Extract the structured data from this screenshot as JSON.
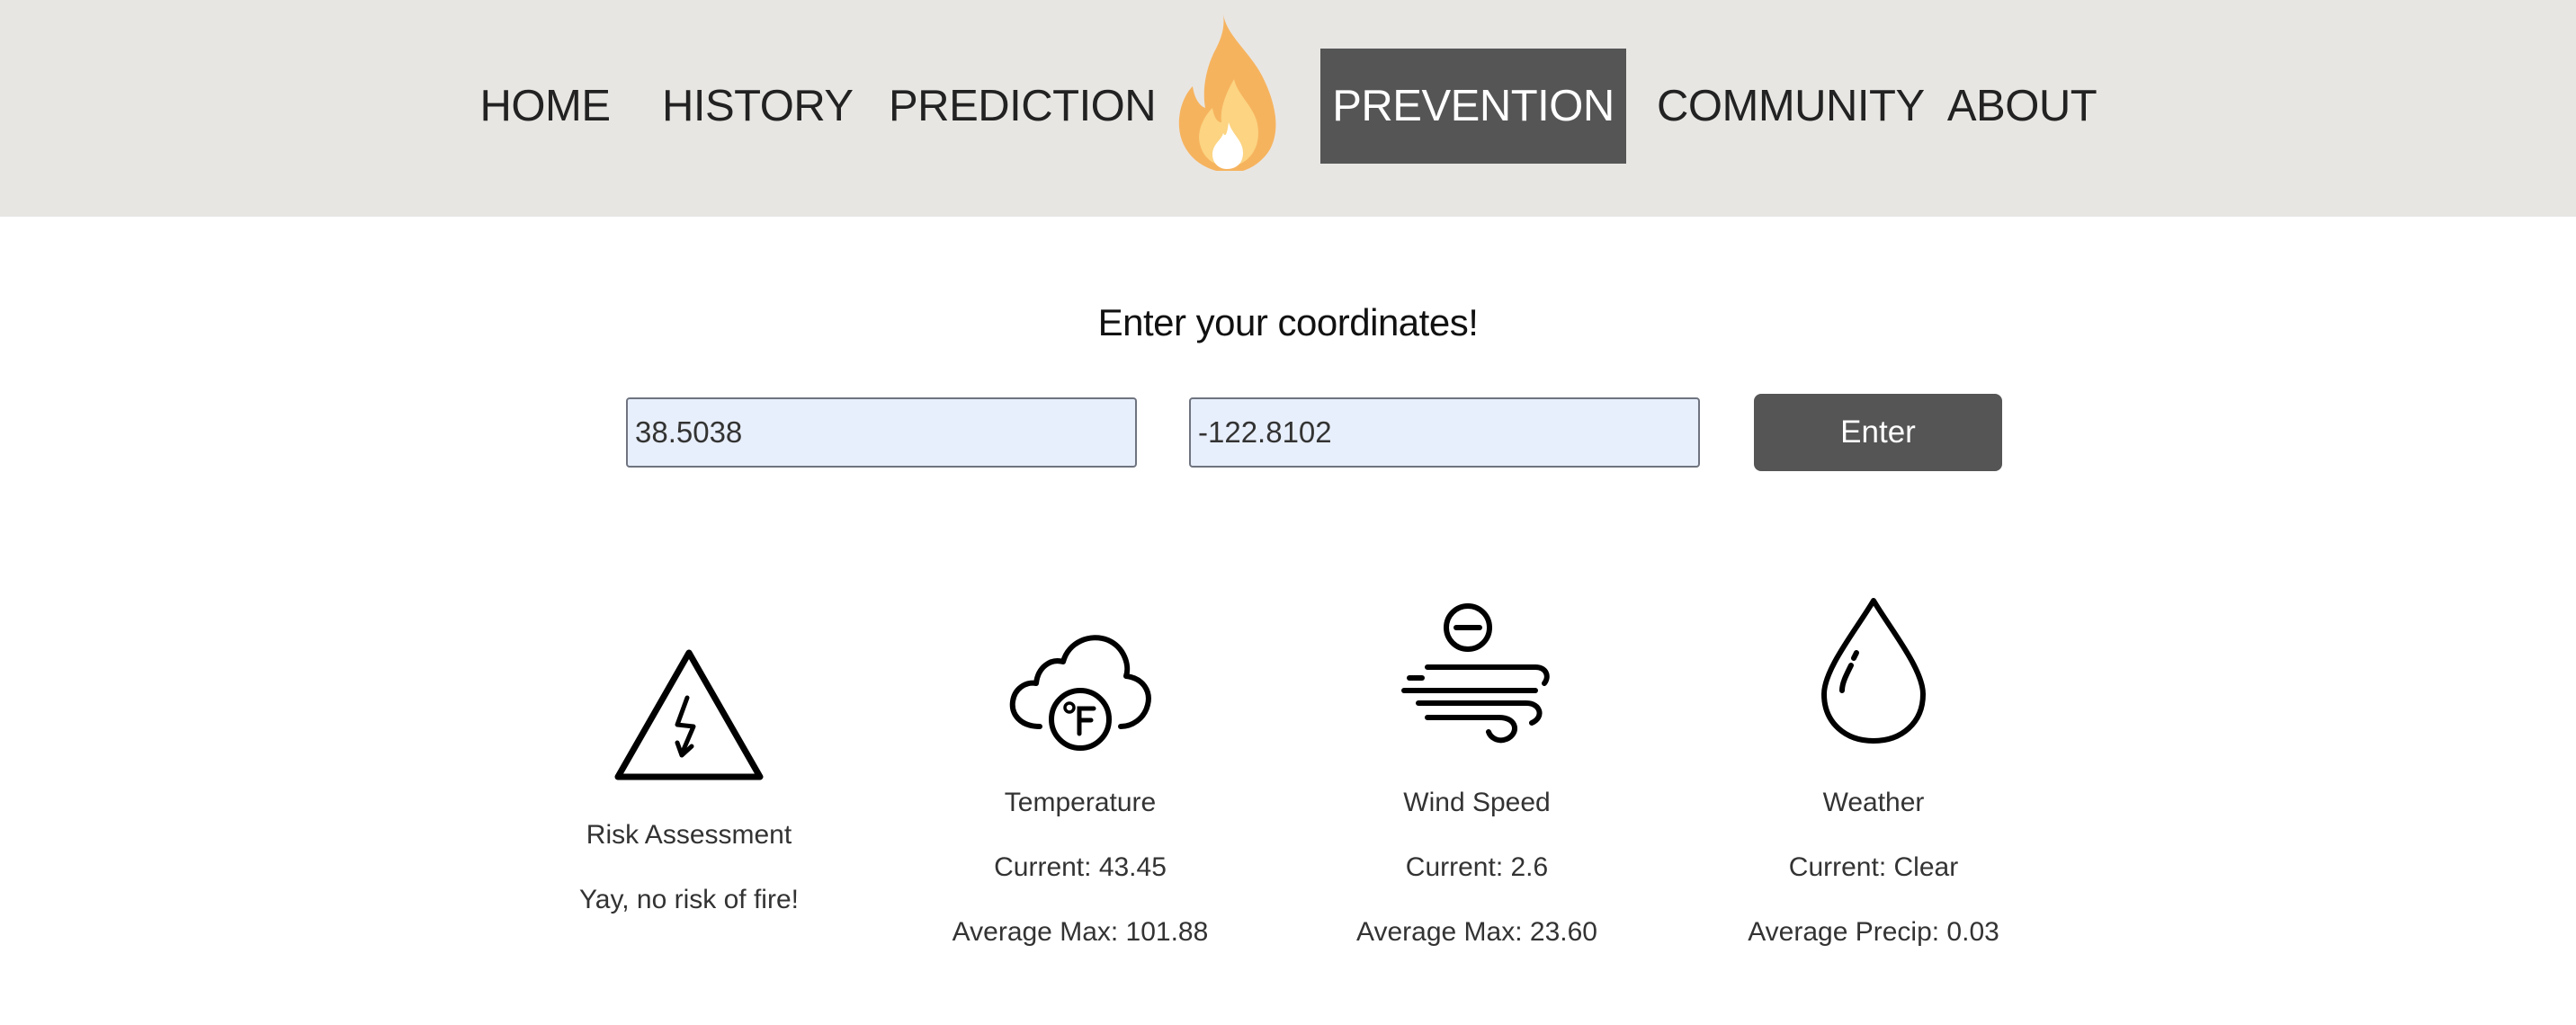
{
  "nav": {
    "items": [
      {
        "label": "HOME"
      },
      {
        "label": "HISTORY"
      },
      {
        "label": "PREDICTION"
      },
      {
        "label": "PREVENTION",
        "active": true
      },
      {
        "label": "COMMUNITY"
      },
      {
        "label": "ABOUT"
      }
    ],
    "logo_icon": "flame-icon"
  },
  "form": {
    "heading": "Enter your coordinates!",
    "latitude_value": "38.5038",
    "longitude_value": "-122.8102",
    "submit_label": "Enter"
  },
  "cards": {
    "risk": {
      "icon": "high-voltage-warning-icon",
      "title": "Risk Assessment",
      "result": "Yay, no risk of fire!"
    },
    "temperature": {
      "icon": "cloud-fahrenheit-icon",
      "title": "Temperature",
      "current": "Current: 43.45",
      "average": "Average Max: 101.88"
    },
    "wind": {
      "icon": "wind-icon",
      "title": "Wind Speed",
      "current": "Current: 2.6",
      "average": "Average Max: 23.60"
    },
    "weather": {
      "icon": "water-drop-icon",
      "title": "Weather",
      "current": "Current: Clear",
      "average": "Average Precip: 0.03"
    }
  },
  "colors": {
    "nav_background": "#e8e6e3",
    "active_nav": "#555555",
    "button": "#555555",
    "input_background": "#e8effc",
    "flame_outer": "#f6b35e",
    "flame_inner": "#fcd482"
  }
}
